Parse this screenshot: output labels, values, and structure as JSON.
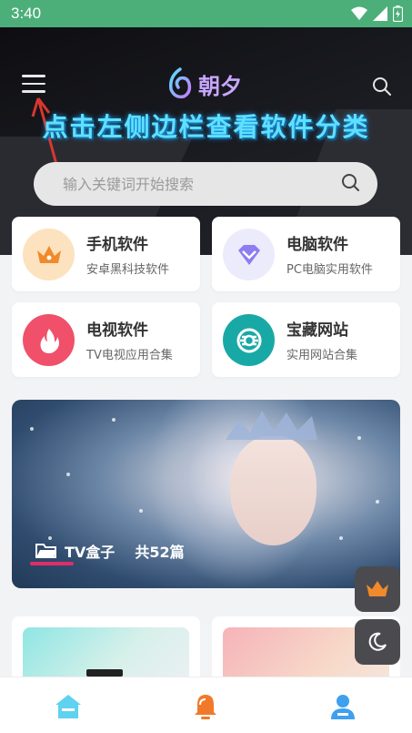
{
  "status_bar": {
    "time": "3:40"
  },
  "header": {
    "logo_text": "朝夕",
    "banner_text": "点击左侧边栏查看软件分类",
    "search_placeholder": "输入关键词开始搜索"
  },
  "categories": [
    {
      "title": "手机软件",
      "subtitle": "安卓黑科技软件",
      "icon": "crown-icon",
      "color": "#f08a2c"
    },
    {
      "title": "电脑软件",
      "subtitle": "PC电脑实用软件",
      "icon": "diamond-icon",
      "color": "#8e7cf0"
    },
    {
      "title": "电视软件",
      "subtitle": "TV电视应用合集",
      "icon": "flame-icon",
      "color": "#f0506a"
    },
    {
      "title": "宝藏网站",
      "subtitle": "实用网站合集",
      "icon": "globe-icon",
      "color": "#18a9a6"
    }
  ],
  "feature": {
    "category": "TV盒子",
    "count_text": "共52篇"
  },
  "float_buttons": [
    "crown-icon",
    "moon-icon"
  ],
  "bottom_nav": [
    "home-icon",
    "bell-icon",
    "user-icon"
  ],
  "colors": {
    "status_green": "#4caf7a",
    "accent_pink": "#e02d6a",
    "banner_cyan": "#5fe0ff"
  }
}
